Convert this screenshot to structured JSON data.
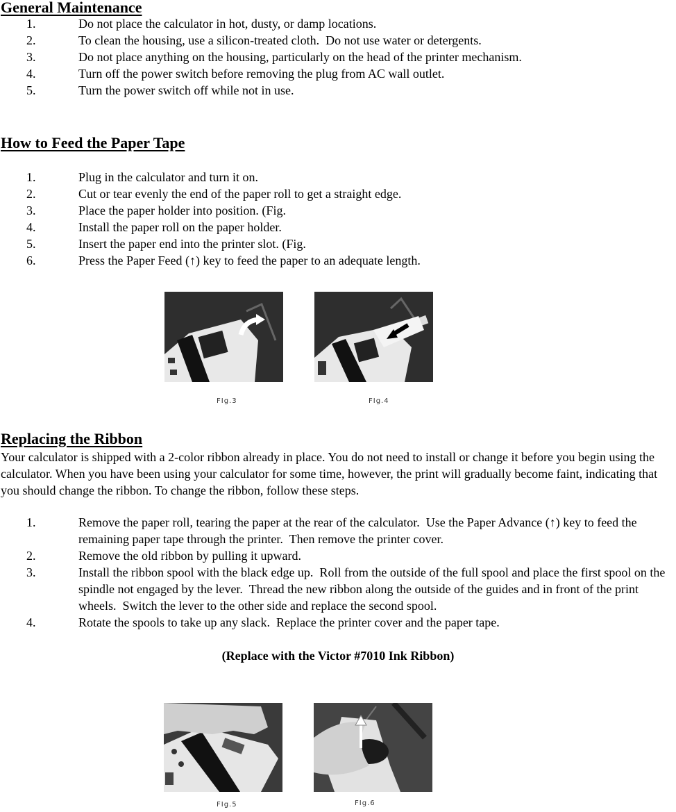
{
  "general_maintenance": {
    "title": "General Maintenance",
    "items": [
      {
        "num": "1.",
        "text": "Do not place the calculator in hot, dusty, or damp locations."
      },
      {
        "num": "2.",
        "text": "To clean the housing, use a silicon-treated cloth.  Do not use water or detergents."
      },
      {
        "num": "3.",
        "text": "Do not place anything on the housing, particularly on the head of the printer mechanism."
      },
      {
        "num": "4.",
        "text": "Turn off the power switch before removing the plug from AC wall outlet."
      },
      {
        "num": "5.",
        "text": "Turn the power switch off while not in use."
      }
    ]
  },
  "feed_paper": {
    "title": "How to Feed the Paper Tape",
    "items": [
      {
        "num": "1.",
        "text": "Plug in the calculator and turn it on."
      },
      {
        "num": "2.",
        "text": "Cut or tear evenly the end of the paper roll to get a straight edge."
      },
      {
        "num": "3.",
        "text": "Place the paper holder into position. (Fig."
      },
      {
        "num": "4.",
        "text": "Install the paper roll on the paper holder."
      },
      {
        "num": "5.",
        "text": "Insert the paper end into the printer slot. (Fig."
      },
      {
        "num": "6.",
        "text": "Press the Paper Feed (↑) key to feed the paper to an adequate length."
      }
    ],
    "figures": [
      {
        "caption": "FIg.3",
        "description": "Calculator with curved arrow showing paper holder placement"
      },
      {
        "caption": "FIg.4",
        "description": "Calculator with arrow showing paper inserted into printer slot"
      }
    ]
  },
  "replace_ribbon": {
    "title": "Replacing the Ribbon",
    "intro": "Your calculator is shipped with a 2-color ribbon already in place.  You do not need to install or change it before you begin using the calculator.  When you have been using your calculator for some time, however, the print will gradually become faint, indicating that you should change the ribbon.  To change the ribbon, follow these steps.",
    "items": [
      {
        "num": "1.",
        "text": "Remove the paper roll, tearing the paper at the rear of the calculator.  Use the Paper Advance (↑) key to feed the remaining paper tape through the printer.  Then remove the printer cover."
      },
      {
        "num": "2.",
        "text": "Remove the old ribbon by pulling it upward."
      },
      {
        "num": "3.",
        "text": "Install the ribbon spool with the black edge up.  Roll from the outside of the full spool and place the first spool on the spindle not engaged by the lever.  Thread the new ribbon along the outside of the guides and in front of the print wheels.  Switch the lever to the other side and replace the second spool."
      },
      {
        "num": "4.",
        "text": "Rotate the spools to take up any slack.  Replace the printer cover and the paper tape."
      }
    ],
    "note": "(Replace with the Victor #7010 Ink Ribbon)",
    "figures": [
      {
        "caption": "FIg.5",
        "description": "Hand removing printer cover from calculator"
      },
      {
        "caption": "FIg.6",
        "description": "Hand lifting ribbon spool upward with arrow"
      }
    ]
  }
}
